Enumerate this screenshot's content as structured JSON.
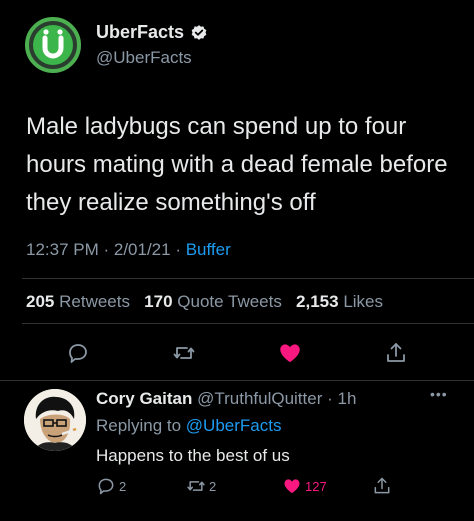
{
  "tweet": {
    "display_name": "UberFacts",
    "handle": "@UberFacts",
    "text": "Male ladybugs can spend up to four hours mating with a dead female before they realize something's off",
    "time": "12:37 PM",
    "sep1": " · ",
    "date": "2/01/21",
    "sep2": " · ",
    "source": "Buffer",
    "retweets": "205",
    "retweets_label": "Retweets",
    "quotes": "170",
    "quotes_label": "Quote Tweets",
    "likes": "2,153",
    "likes_label": "Likes",
    "liked": true,
    "accent_like": "#f91880",
    "accent_link": "#1d9bf0"
  },
  "reply": {
    "name": "Cory Gaitan",
    "handle": "@TruthfulQuitter",
    "sep": " · ",
    "time": "1h",
    "replying_prefix": "Replying to",
    "replying_to": "@UberFacts",
    "text": "Happens to the best of us",
    "reply_count": "2",
    "retweet_count": "2",
    "like_count": "127"
  },
  "icons": {
    "verified": "verified-badge-icon",
    "more": "more-dots-icon",
    "reply": "reply-bubble-icon",
    "retweet": "retweet-icon",
    "like": "heart-icon",
    "share": "share-icon"
  }
}
